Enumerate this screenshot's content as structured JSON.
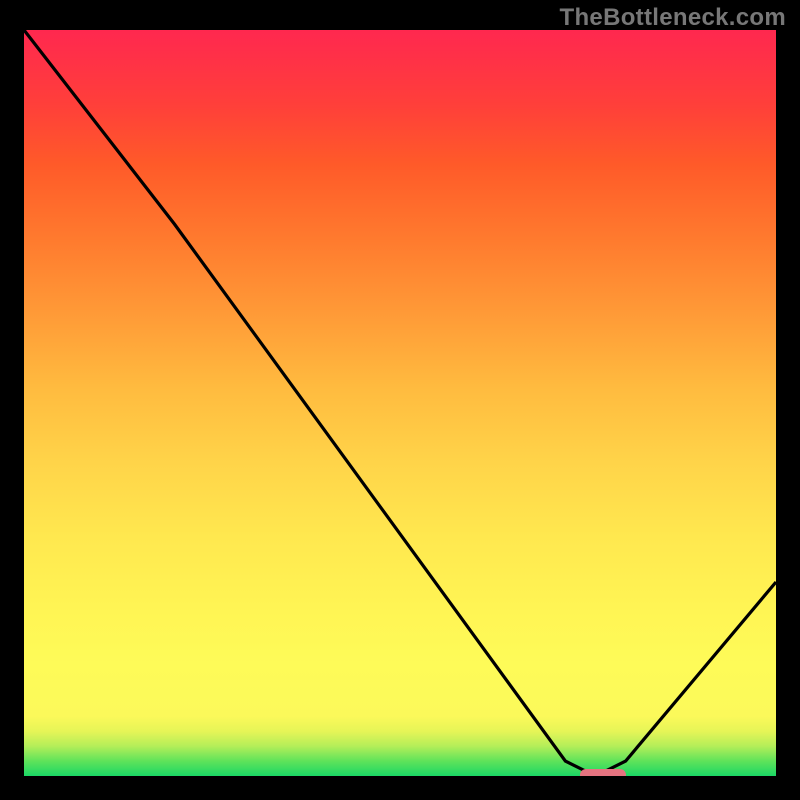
{
  "watermark": "TheBottleneck.com",
  "chart_data": {
    "type": "line",
    "title": "",
    "xlabel": "",
    "ylabel": "",
    "xlim": [
      0,
      100
    ],
    "ylim": [
      0,
      100
    ],
    "x": [
      0,
      20,
      72,
      76,
      80,
      100
    ],
    "values": [
      100,
      74,
      2,
      0,
      2,
      26
    ],
    "marker": {
      "x_center": 77,
      "y": 0,
      "width_pct": 6
    },
    "colors": {
      "top": "#ff284f",
      "mid_top": "#ff9a37",
      "mid": "#fefb58",
      "bottom": "#1bd765",
      "curve": "#000000",
      "marker": "#e57380"
    }
  }
}
